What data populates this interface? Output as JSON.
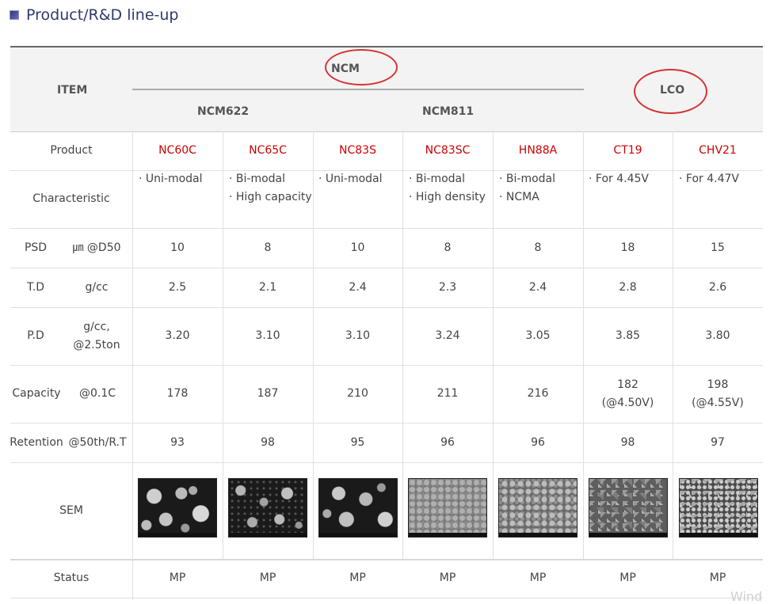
{
  "page_title": "Product/R&D line-up",
  "header": {
    "item": "ITEM",
    "ncm": "NCM",
    "lco": "LCO",
    "ncm622": "NCM622",
    "ncm811": "NCM811"
  },
  "products": [
    "NC60C",
    "NC65C",
    "NC83S",
    "NC83SC",
    "HN88A",
    "CT19",
    "CHV21"
  ],
  "rows": {
    "product": "Product",
    "characteristic": "Characteristic",
    "psd": {
      "label": "PSD",
      "unit": "㎛ @D50"
    },
    "td": {
      "label": "T.D",
      "unit": "g/cc"
    },
    "pd": {
      "label": "P.D",
      "unit1": "g/cc,",
      "unit2": "@2.5ton"
    },
    "capacity": {
      "label": "Capacity",
      "unit": "@0.1C"
    },
    "retention": {
      "label": "Retention",
      "unit": "@50th/R.T"
    },
    "sem": "SEM",
    "status": "Status"
  },
  "characteristics": [
    [
      "· Uni-modal"
    ],
    [
      "· Bi-modal",
      "· High capacity"
    ],
    [
      "· Uni-modal"
    ],
    [
      "· Bi-modal",
      "· High density"
    ],
    [
      "· Bi-modal",
      "· NCMA"
    ],
    [
      "· For 4.45V"
    ],
    [
      "· For 4.47V"
    ]
  ],
  "psd": [
    "10",
    "8",
    "10",
    "8",
    "8",
    "18",
    "15"
  ],
  "td": [
    "2.5",
    "2.1",
    "2.4",
    "2.3",
    "2.4",
    "2.8",
    "2.6"
  ],
  "pd": [
    "3.20",
    "3.10",
    "3.10",
    "3.24",
    "3.05",
    "3.85",
    "3.80"
  ],
  "capacity": [
    [
      "178"
    ],
    [
      "187"
    ],
    [
      "210"
    ],
    [
      "211"
    ],
    [
      "216"
    ],
    [
      "182",
      "(@4.50V)"
    ],
    [
      "198",
      "(@4.55V)"
    ]
  ],
  "retention": [
    "93",
    "98",
    "95",
    "96",
    "96",
    "98",
    "97"
  ],
  "status": [
    "MP",
    "MP",
    "MP",
    "MP",
    "MP",
    "MP",
    "MP"
  ],
  "watermark": "Wind"
}
